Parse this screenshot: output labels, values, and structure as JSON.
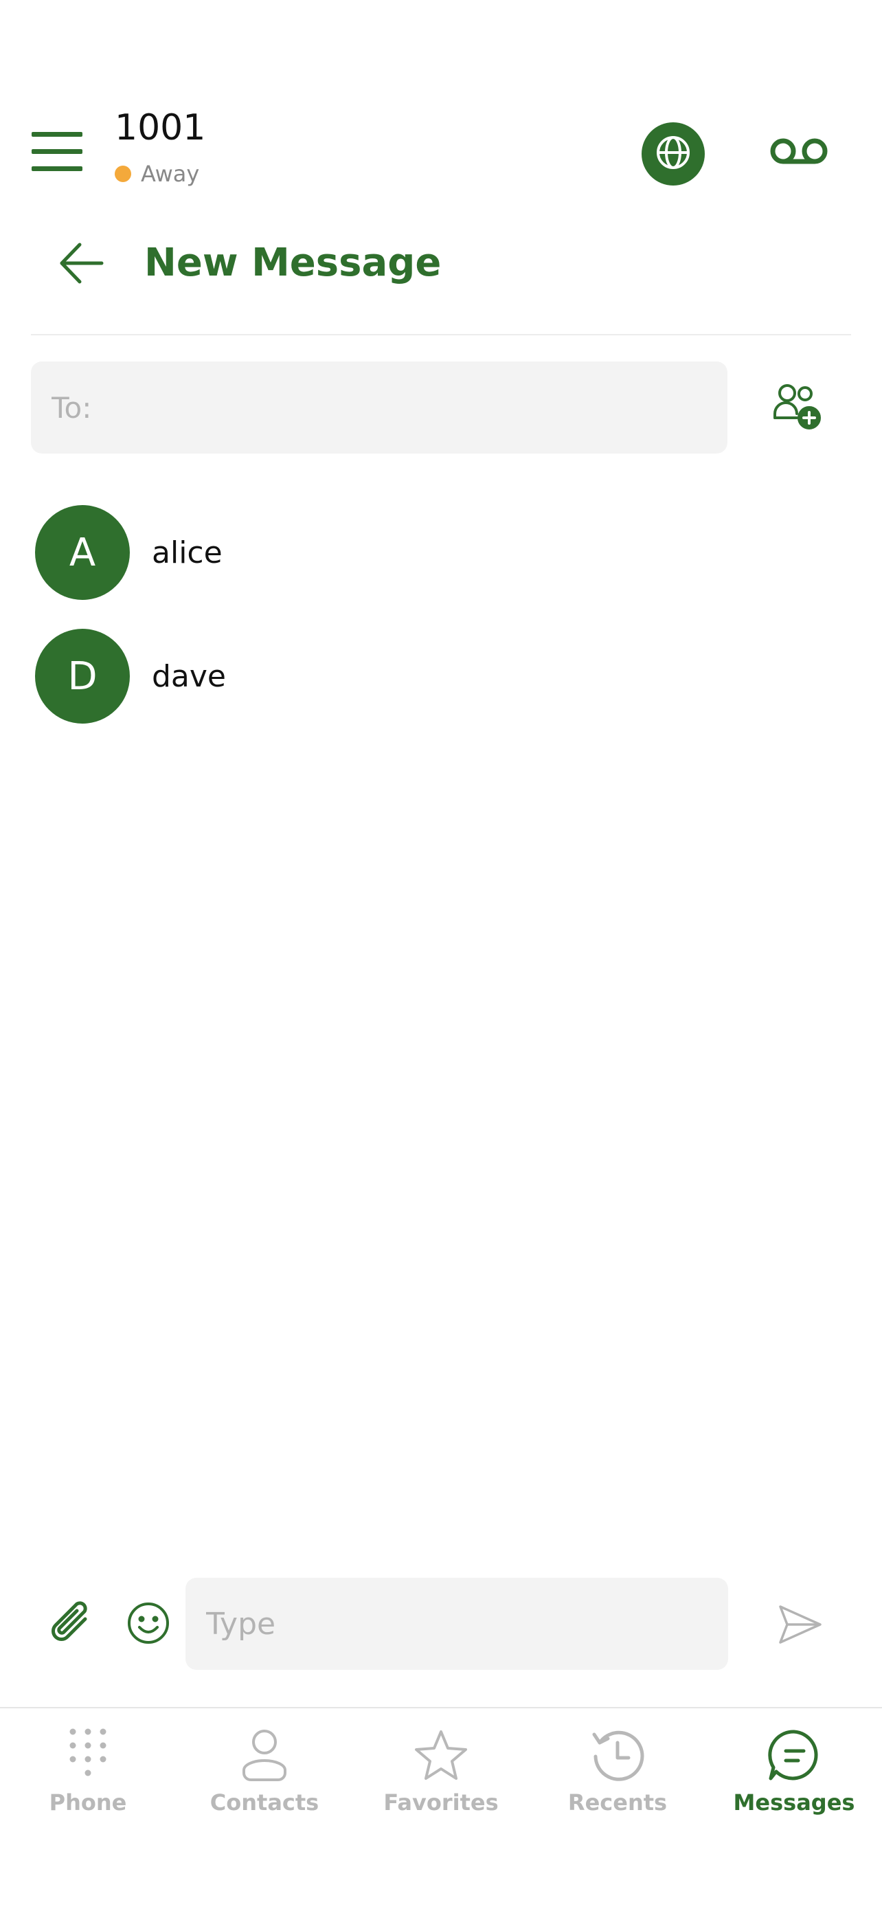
{
  "header": {
    "extension": "1001",
    "status": "Away",
    "status_color": "#f4a93b",
    "icons": [
      "menu-icon",
      "globe-icon",
      "voicemail-icon"
    ]
  },
  "title_row": {
    "title": "New Message",
    "back_icon": "arrow-left-icon"
  },
  "recipient": {
    "placeholder": "To:",
    "value": "",
    "add_icon": "add-contact-icon"
  },
  "contacts": [
    {
      "initial": "A",
      "name": "alice"
    },
    {
      "initial": "D",
      "name": "dave"
    }
  ],
  "composer": {
    "placeholder": "Type",
    "value": "",
    "icons": [
      "paperclip-icon",
      "emoji-icon",
      "send-icon"
    ]
  },
  "nav": {
    "items": [
      {
        "label": "Phone",
        "icon": "dialpad-icon",
        "active": false
      },
      {
        "label": "Contacts",
        "icon": "person-icon",
        "active": false
      },
      {
        "label": "Favorites",
        "icon": "star-icon",
        "active": false
      },
      {
        "label": "Recents",
        "icon": "history-icon",
        "active": false
      },
      {
        "label": "Messages",
        "icon": "chat-icon",
        "active": true
      }
    ]
  },
  "colors": {
    "accent": "#2f6f2d",
    "inactive": "#b8b8b8",
    "field_bg": "#f3f3f3"
  }
}
